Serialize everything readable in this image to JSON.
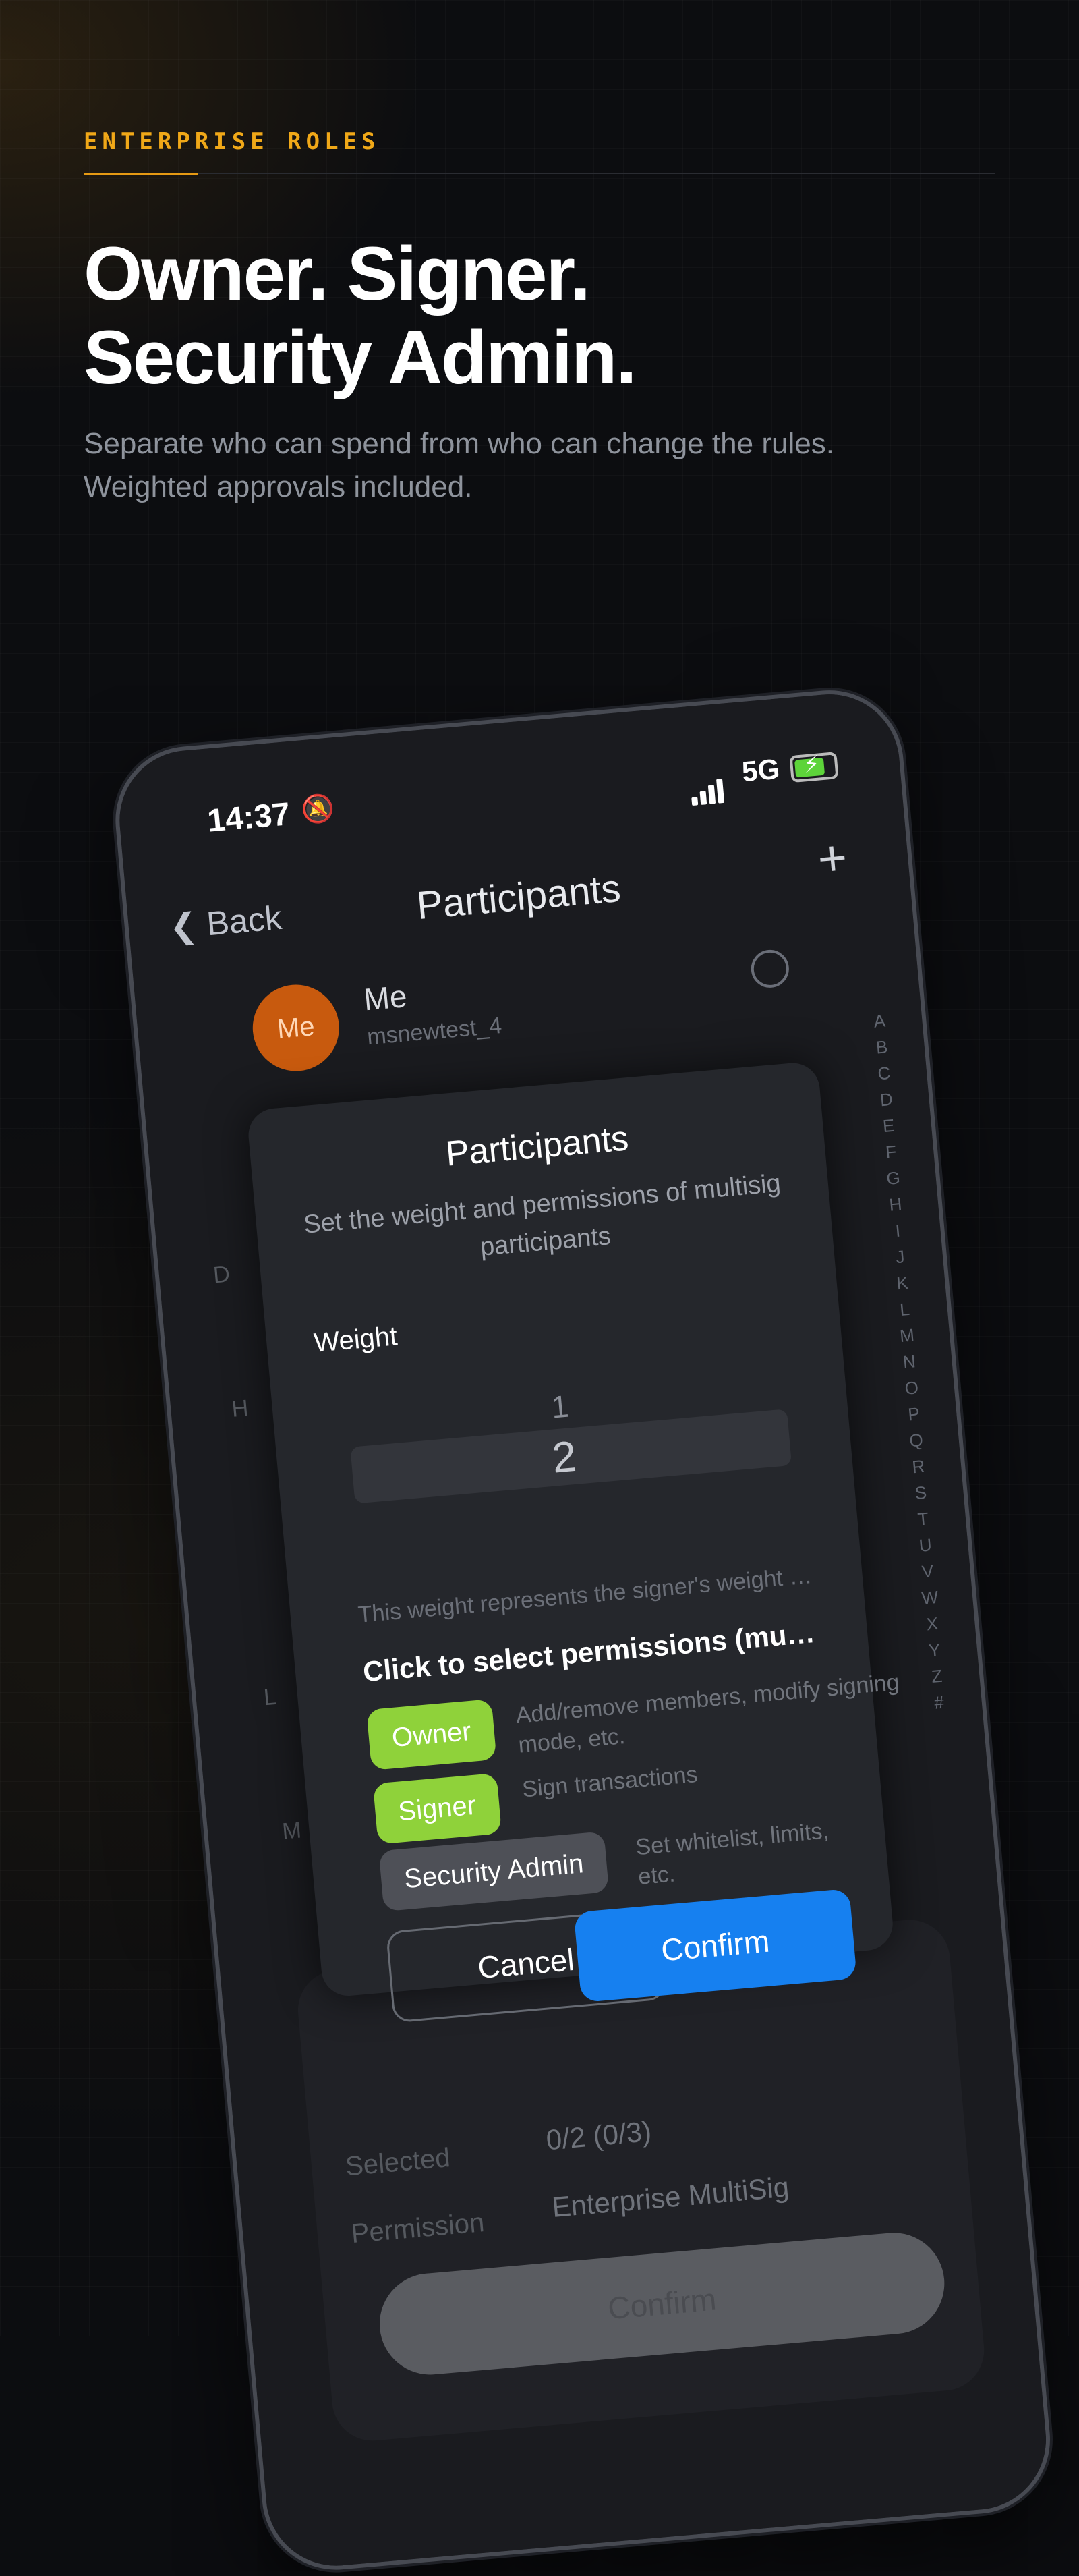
{
  "promo": {
    "eyebrow": "ENTERPRISE ROLES",
    "headline_line1": "Owner. Signer.",
    "headline_line2": "Security Admin.",
    "subtitle": "Separate who can spend from who can change the rules. Weighted approvals included."
  },
  "status_bar": {
    "time": "14:37",
    "network": "5G"
  },
  "nav": {
    "back_label": "Back",
    "title": "Participants"
  },
  "contact": {
    "avatar_text": "Me",
    "name": "Me",
    "username": "msnewtest_4"
  },
  "alphabet_index": [
    "A",
    "B",
    "C",
    "D",
    "E",
    "F",
    "G",
    "H",
    "I",
    "J",
    "K",
    "L",
    "M",
    "N",
    "O",
    "P",
    "Q",
    "R",
    "S",
    "T",
    "U",
    "V",
    "W",
    "X",
    "Y",
    "Z",
    "#"
  ],
  "background_rows": {
    "selected_label": "Selected",
    "selected_value": "0/2 (0/3)",
    "permission_label": "Permission",
    "permission_value": "Enterprise MultiSig",
    "confirm_label": "Confirm"
  },
  "modal": {
    "title": "Participants",
    "subtitle": "Set the weight and permissions of multisig participants",
    "weight_label": "Weight",
    "weight_prev": "1",
    "weight_value": "2",
    "weight_hint": "This weight represents the signer's weight under t...",
    "permissions_title": "Click to select permissions (multiple allowe...",
    "permissions": [
      {
        "name": "Owner",
        "description": "Add/remove members, modify signing mode, etc.",
        "selected": true
      },
      {
        "name": "Signer",
        "description": "Sign transactions",
        "selected": true
      },
      {
        "name": "Security Admin",
        "description": "Set whitelist, limits, etc.",
        "selected": false
      }
    ],
    "cancel_label": "Cancel",
    "confirm_label": "Confirm"
  },
  "colors": {
    "accent": "#f0a818",
    "selected_chip": "#8fd23a",
    "primary_button": "#1680f0",
    "avatar": "#c85a0e"
  }
}
